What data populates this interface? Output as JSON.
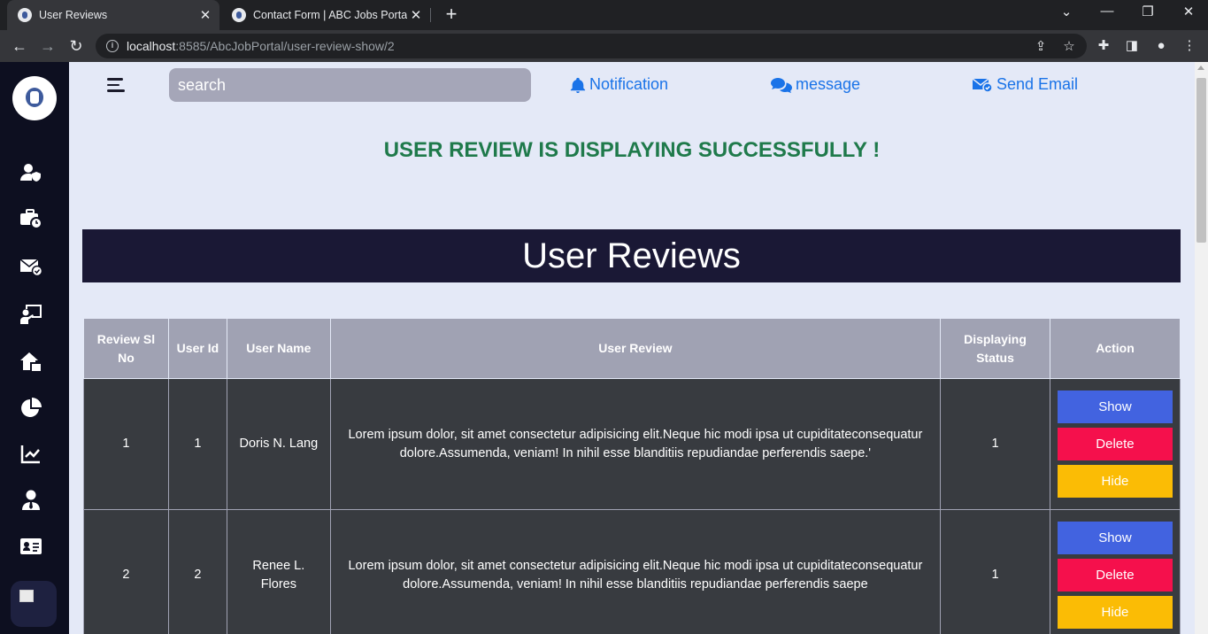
{
  "browser": {
    "tabs": [
      {
        "title": "User Reviews",
        "active": true
      },
      {
        "title": "Contact Form | ABC Jobs Portal",
        "active": false
      }
    ],
    "url_host": "localhost",
    "url_rest": ":8585/AbcJobPortal/user-review-show/2"
  },
  "topbar": {
    "search_placeholder": "search",
    "links": {
      "notification": "Notification",
      "message": "message",
      "send_email": "Send Email"
    }
  },
  "sidebar": {
    "items": [
      "user-shield-icon",
      "briefcase-clock-icon",
      "envelope-check-icon",
      "presentation-icon",
      "house-icon",
      "pie-chart-icon",
      "line-chart-icon",
      "user-tie-icon",
      "id-card-icon"
    ]
  },
  "success_message": "USER REVIEW IS DISPLAYING SUCCESSFULLY !",
  "page_title": "User Reviews",
  "table": {
    "headers": {
      "sl_no": "Review Sl No",
      "user_id": "User Id",
      "user_name": "User Name",
      "user_review": "User Review",
      "status": "Displaying Status",
      "action": "Action"
    },
    "rows": [
      {
        "sl_no": "1",
        "user_id": "1",
        "user_name": "Doris N. Lang",
        "review": "Lorem ipsum dolor, sit amet consectetur adipisicing elit.Neque hic modi ipsa ut cupiditateconsequatur dolore.Assumenda, veniam! In nihil esse blanditiis repudiandae perferendis saepe.'",
        "status": "1"
      },
      {
        "sl_no": "2",
        "user_id": "2",
        "user_name": "Renee L. Flores",
        "review": "Lorem ipsum dolor, sit amet consectetur adipisicing elit.Neque hic modi ipsa ut cupiditateconsequatur dolore.Assumenda, veniam! In nihil esse blanditiis repudiandae perferendis saepe",
        "status": "1"
      }
    ],
    "buttons": {
      "show": "Show",
      "delete": "Delete",
      "hide": "Hide"
    }
  },
  "colors": {
    "sidebar": "#0d0f20",
    "content_bg": "#e4e9f7",
    "success": "#1f7a4b",
    "banner": "#1a1835",
    "show": "#4263e0",
    "delete": "#f5104c",
    "hide": "#fbbc05"
  }
}
